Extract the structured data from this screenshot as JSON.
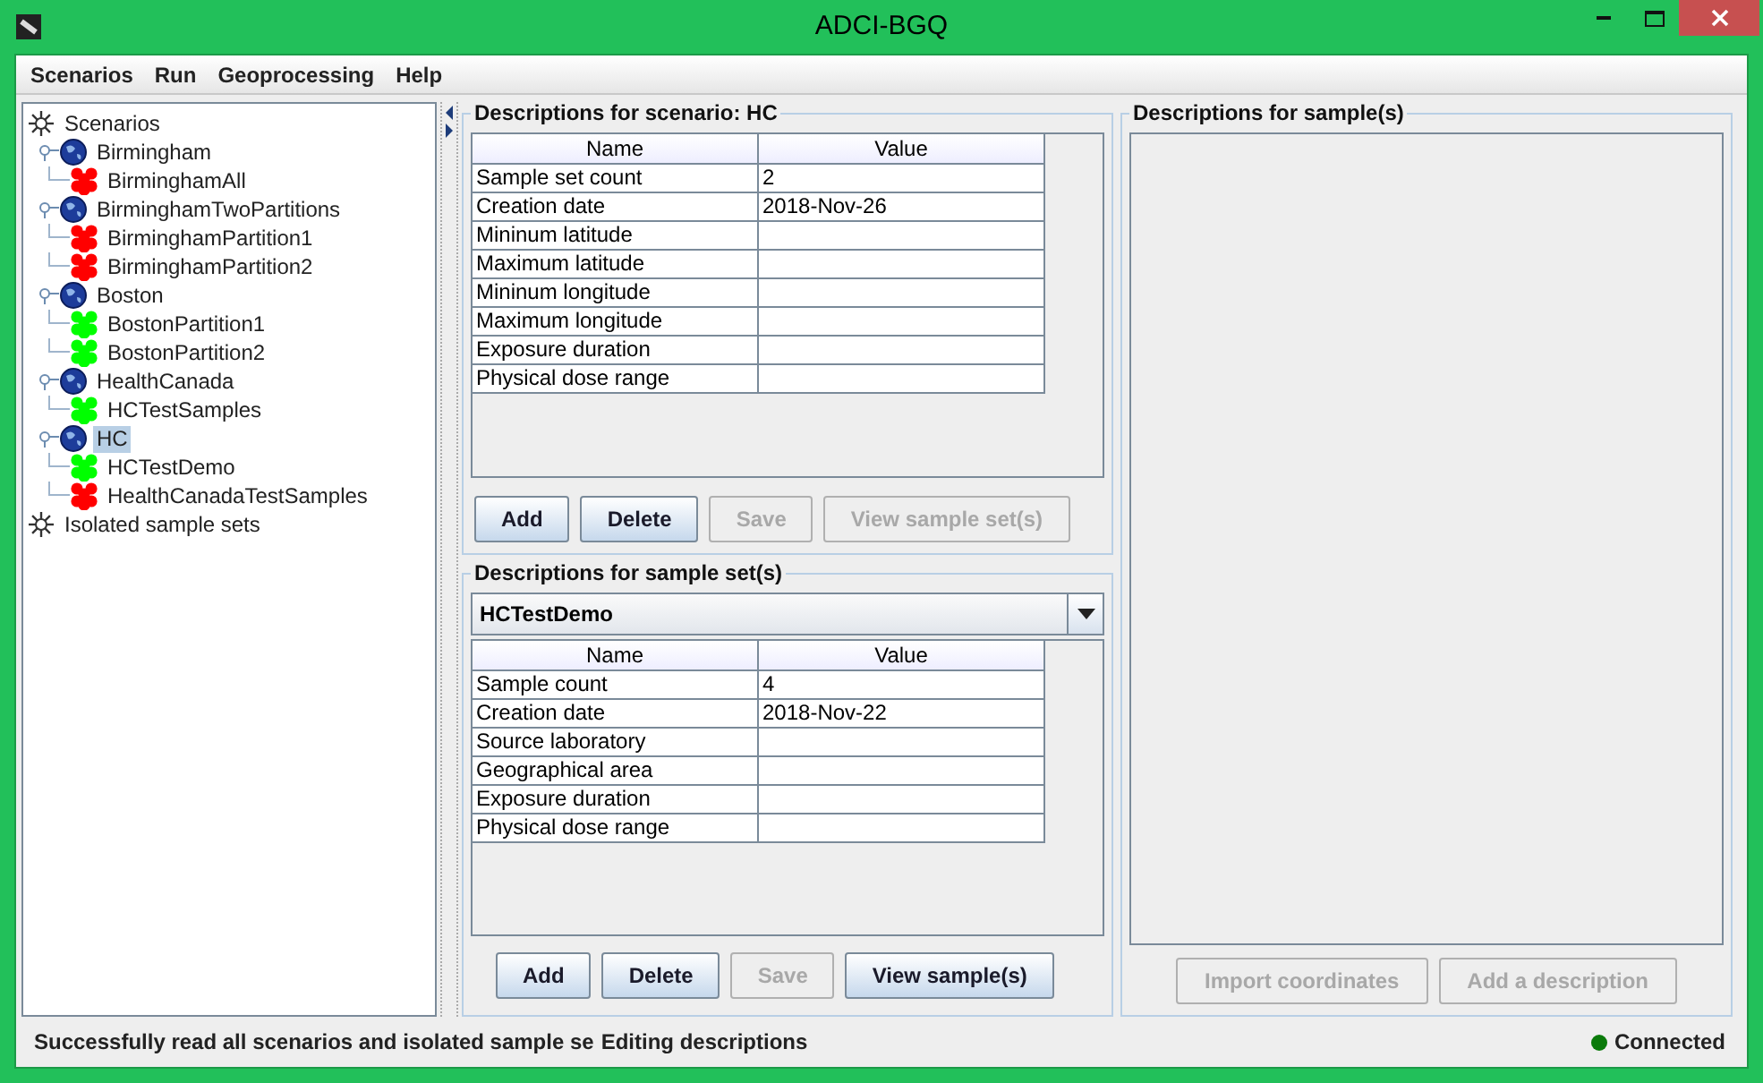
{
  "window": {
    "title": "ADCI-BGQ"
  },
  "menu": [
    "Scenarios",
    "Run",
    "Geoprocessing",
    "Help"
  ],
  "tree": [
    {
      "label": "Scenarios",
      "kind": "root",
      "selected": false,
      "children": [
        {
          "label": "Birmingham",
          "kind": "scenario",
          "expanded": true,
          "selected": false,
          "children": [
            {
              "label": "BirminghamAll",
              "kind": "sample_set",
              "color": "#ff0000",
              "selected": false
            }
          ]
        },
        {
          "label": "BirminghamTwoPartitions",
          "kind": "scenario",
          "expanded": true,
          "selected": false,
          "children": [
            {
              "label": "BirminghamPartition1",
              "kind": "sample_set",
              "color": "#ff0000",
              "selected": false
            },
            {
              "label": "BirminghamPartition2",
              "kind": "sample_set",
              "color": "#ff0000",
              "selected": false
            }
          ]
        },
        {
          "label": "Boston",
          "kind": "scenario",
          "expanded": true,
          "selected": false,
          "children": [
            {
              "label": "BostonPartition1",
              "kind": "sample_set",
              "color": "#00ff00",
              "selected": false
            },
            {
              "label": "BostonPartition2",
              "kind": "sample_set",
              "color": "#00ff00",
              "selected": false
            }
          ]
        },
        {
          "label": "HealthCanada",
          "kind": "scenario",
          "expanded": true,
          "selected": false,
          "children": [
            {
              "label": "HCTestSamples",
              "kind": "sample_set",
              "color": "#00ff00",
              "selected": false
            }
          ]
        },
        {
          "label": "HC",
          "kind": "scenario",
          "expanded": true,
          "selected": true,
          "children": [
            {
              "label": "HCTestDemo",
              "kind": "sample_set",
              "color": "#00ff00",
              "selected": false
            },
            {
              "label": "HealthCanadaTestSamples",
              "kind": "sample_set",
              "color": "#ff0000",
              "selected": false
            }
          ]
        }
      ]
    },
    {
      "label": "Isolated sample sets",
      "kind": "root",
      "selected": false
    }
  ],
  "scenario_panel": {
    "title": "Descriptions for scenario: HC",
    "columns": [
      "Name",
      "Value"
    ],
    "rows": [
      [
        "Sample set count",
        "2"
      ],
      [
        "Creation date",
        "2018-Nov-26"
      ],
      [
        "Mininum latitude",
        ""
      ],
      [
        "Maximum latitude",
        ""
      ],
      [
        "Mininum longitude",
        ""
      ],
      [
        "Maximum longitude",
        ""
      ],
      [
        "Exposure duration",
        ""
      ],
      [
        "Physical dose range",
        ""
      ]
    ],
    "buttons": [
      {
        "label": "Add",
        "disabled": false
      },
      {
        "label": "Delete",
        "disabled": false
      },
      {
        "label": "Save",
        "disabled": true
      },
      {
        "label": "View sample set(s)",
        "disabled": true
      }
    ]
  },
  "sample_set_panel": {
    "title": "Descriptions for sample set(s)",
    "dropdown": "HCTestDemo",
    "columns": [
      "Name",
      "Value"
    ],
    "rows": [
      [
        "Sample count",
        "4"
      ],
      [
        "Creation date",
        "2018-Nov-22"
      ],
      [
        "Source laboratory",
        ""
      ],
      [
        "Geographical area",
        ""
      ],
      [
        "Exposure duration",
        ""
      ],
      [
        "Physical dose range",
        ""
      ]
    ],
    "buttons": [
      {
        "label": "Add",
        "disabled": false
      },
      {
        "label": "Delete",
        "disabled": false
      },
      {
        "label": "Save",
        "disabled": true
      },
      {
        "label": "View sample(s)",
        "disabled": false
      }
    ]
  },
  "sample_panel": {
    "title": "Descriptions for sample(s)",
    "buttons": [
      {
        "label": "Import coordinates",
        "disabled": true
      },
      {
        "label": "Add a description",
        "disabled": true
      }
    ]
  },
  "status_bar": {
    "messages": [
      "Successfully read all scenarios and isolated sample se",
      "Editing descriptions"
    ],
    "connection": "Connected",
    "connected": true
  }
}
